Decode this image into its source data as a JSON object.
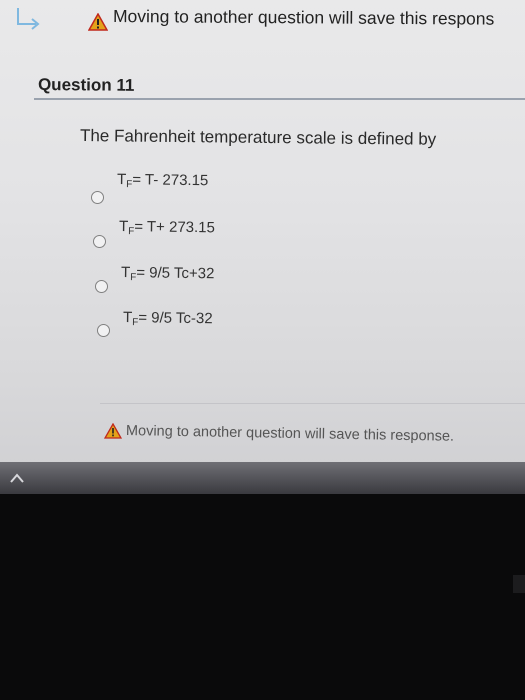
{
  "banner": {
    "text": "Moving to another question will save this respons"
  },
  "question": {
    "title": "Question 11",
    "prompt": "The Fahrenheit temperature scale is defined by",
    "options": [
      {
        "main": "T",
        "sub": "F",
        "rest": "= T- 273.15"
      },
      {
        "main": "T",
        "sub": "F",
        "rest": "= T+ 273.15"
      },
      {
        "main": "T",
        "sub": "F",
        "rest": "= 9/5 Tc+32"
      },
      {
        "main": "T",
        "sub": "F",
        "rest": "= 9/5 Tc-32"
      }
    ]
  },
  "footer": {
    "warning": "Moving to another question will save this response."
  },
  "icons": {
    "return": "return-arrow-icon",
    "warning": "warning-icon",
    "chevron": "chevron-up-icon"
  },
  "colors": {
    "warning_fill": "#e3a21a",
    "warning_border": "#c0281c",
    "accent": "#2b8cd6"
  }
}
